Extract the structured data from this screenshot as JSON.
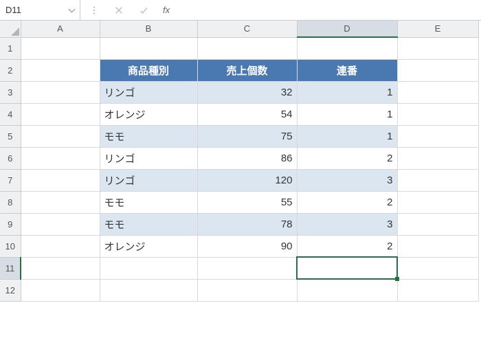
{
  "nameBox": "D11",
  "formula": "",
  "columns": [
    "A",
    "B",
    "C",
    "D",
    "E"
  ],
  "activeCol": "D",
  "activeRow": 11,
  "rowCount": 12,
  "headers": {
    "b": "商品種別",
    "c": "売上個数",
    "d": "連番"
  },
  "rows": [
    {
      "product": "リンゴ",
      "qty": "32",
      "seq": "1"
    },
    {
      "product": "オレンジ",
      "qty": "54",
      "seq": "1"
    },
    {
      "product": "モモ",
      "qty": "75",
      "seq": "1"
    },
    {
      "product": "リンゴ",
      "qty": "86",
      "seq": "2"
    },
    {
      "product": "リンゴ",
      "qty": "120",
      "seq": "3"
    },
    {
      "product": "モモ",
      "qty": "55",
      "seq": "2"
    },
    {
      "product": "モモ",
      "qty": "78",
      "seq": "3"
    },
    {
      "product": "オレンジ",
      "qty": "90",
      "seq": "2"
    }
  ],
  "chart_data": {
    "type": "table",
    "title": "",
    "columns": [
      "商品種別",
      "売上個数",
      "連番"
    ],
    "data": [
      [
        "リンゴ",
        32,
        1
      ],
      [
        "オレンジ",
        54,
        1
      ],
      [
        "モモ",
        75,
        1
      ],
      [
        "リンゴ",
        86,
        2
      ],
      [
        "リンゴ",
        120,
        3
      ],
      [
        "モモ",
        55,
        2
      ],
      [
        "モモ",
        78,
        3
      ],
      [
        "オレンジ",
        90,
        2
      ]
    ]
  }
}
